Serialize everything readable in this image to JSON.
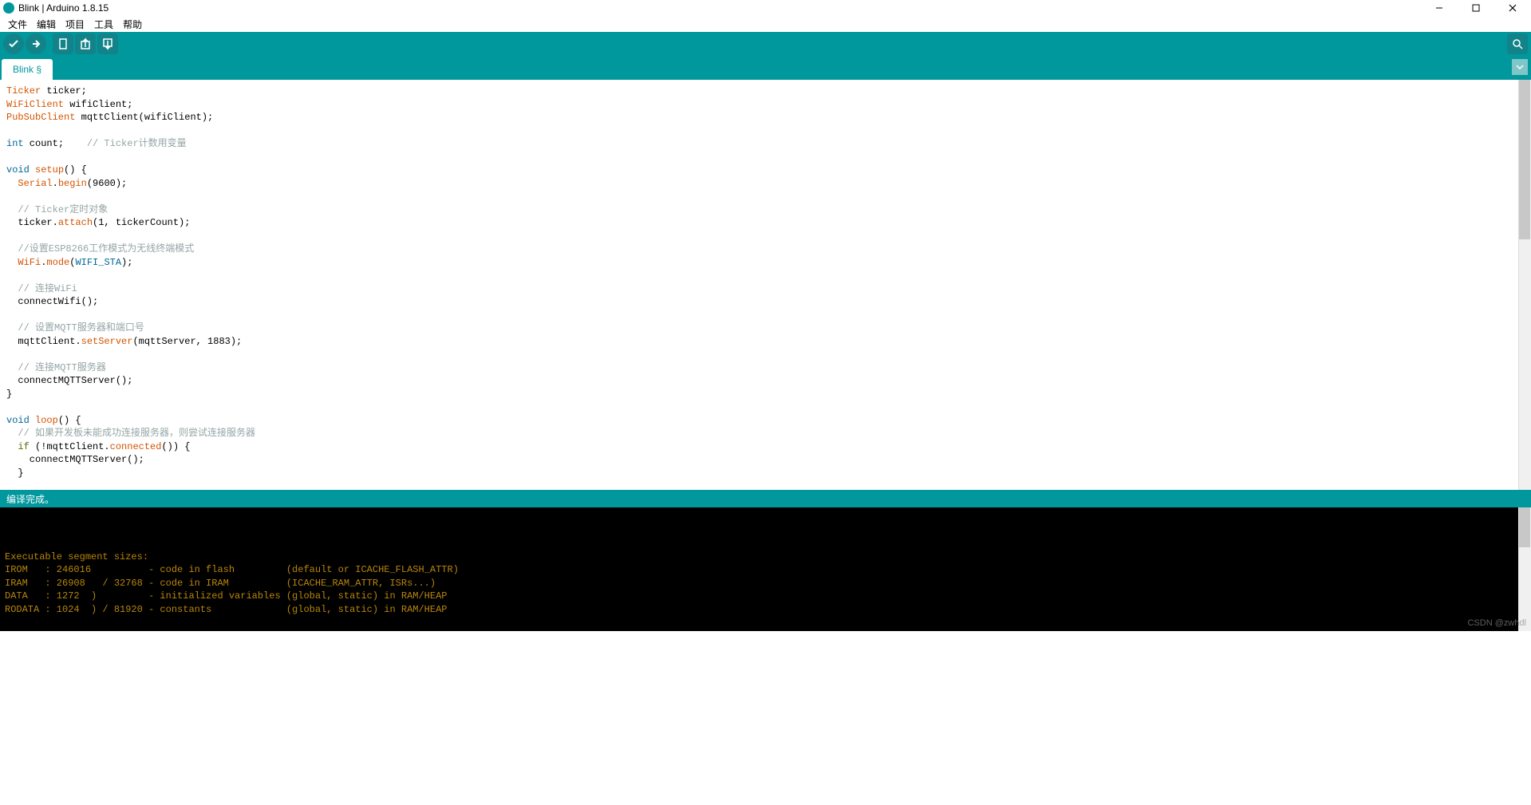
{
  "title": "Blink | Arduino 1.8.15",
  "menu": {
    "file": "文件",
    "edit": "编辑",
    "sketch": "项目",
    "tools": "工具",
    "help": "帮助"
  },
  "tab": {
    "name": "Blink §"
  },
  "status": {
    "text": "编译完成。"
  },
  "watermark": "CSDN @zwhdl",
  "code": {
    "l1_a": "Ticker",
    "l1_b": " ticker;",
    "l2_a": "WiFiClient",
    "l2_b": " wifiClient;",
    "l3_a": "PubSubClient",
    "l3_b": " mqttClient(wifiClient);",
    "l4": "",
    "l5_a": "int",
    "l5_b": " count;    ",
    "l5_c": "// Ticker计数用变量",
    "l6": "",
    "l7_a": "void",
    "l7_b": " ",
    "l7_c": "setup",
    "l7_d": "() {",
    "l8_a": "  ",
    "l8_b": "Serial",
    "l8_c": ".",
    "l8_d": "begin",
    "l8_e": "(9600);",
    "l9": "",
    "l10_a": "  ",
    "l10_b": "// Ticker定时对象",
    "l11_a": "  ticker.",
    "l11_b": "attach",
    "l11_c": "(1, tickerCount);",
    "l12": "",
    "l13_a": "  ",
    "l13_b": "//设置ESP8266工作模式为无线终端模式",
    "l14_a": "  ",
    "l14_b": "WiFi",
    "l14_c": ".",
    "l14_d": "mode",
    "l14_e": "(",
    "l14_f": "WIFI_STA",
    "l14_g": ");",
    "l15": "",
    "l16_a": "  ",
    "l16_b": "// 连接WiFi",
    "l17": "  connectWifi();",
    "l18": "",
    "l19_a": "  ",
    "l19_b": "// 设置MQTT服务器和端口号",
    "l20_a": "  mqttClient.",
    "l20_b": "setServer",
    "l20_c": "(mqttServer, 1883);",
    "l21": "",
    "l22_a": "  ",
    "l22_b": "// 连接MQTT服务器",
    "l23": "  connectMQTTServer();",
    "l24": "}",
    "l25": "",
    "l26_a": "void",
    "l26_b": " ",
    "l26_c": "loop",
    "l26_d": "() {",
    "l27_a": "  ",
    "l27_b": "// 如果开发板未能成功连接服务器，则尝试连接服务器",
    "l28_a": "  ",
    "l28_b": "if",
    "l28_c": " (!mqttClient.",
    "l28_d": "connected",
    "l28_e": "()) {",
    "l29": "    connectMQTTServer();",
    "l30": "  }"
  },
  "console": {
    "l1": "",
    "l2": "",
    "l3": "",
    "l4": "Executable segment sizes:",
    "l5": "IROM   : 246016          - code in flash         (default or ICACHE_FLASH_ATTR)",
    "l6": "IRAM   : 26908   / 32768 - code in IRAM          (ICACHE_RAM_ATTR, ISRs...)",
    "l7": "DATA   : 1272  )         - initialized variables (global, static) in RAM/HEAP",
    "l8": "RODATA : 1024  ) / 81920 - constants             (global, static) in RAM/HEAP"
  }
}
